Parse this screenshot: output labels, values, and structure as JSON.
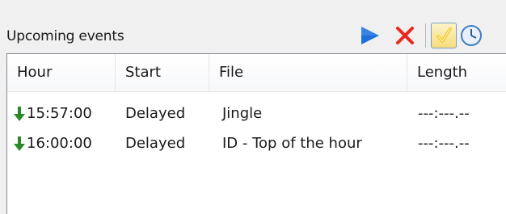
{
  "panel": {
    "title": "Upcoming events"
  },
  "toolbar": {
    "play_icon": "play-icon",
    "stop_icon": "delete-x-icon",
    "check_icon": "checkmark-icon",
    "clock_icon": "clock-icon",
    "colors": {
      "play": "#1e6fd9",
      "stop": "#e8291c",
      "check": "#f0c419"
    }
  },
  "table": {
    "columns": [
      "Hour",
      "Start",
      "File",
      "Length"
    ],
    "rows": [
      {
        "icon": "green-down-arrow-icon",
        "hour": "15:57:00",
        "start": "Delayed",
        "file": "Jingle",
        "length": "---:---.--"
      },
      {
        "icon": "green-down-arrow-icon",
        "hour": "16:00:00",
        "start": "Delayed",
        "file": "ID - Top of the hour",
        "length": "---:---.--"
      }
    ],
    "arrow_color": "#2a8a2a"
  }
}
